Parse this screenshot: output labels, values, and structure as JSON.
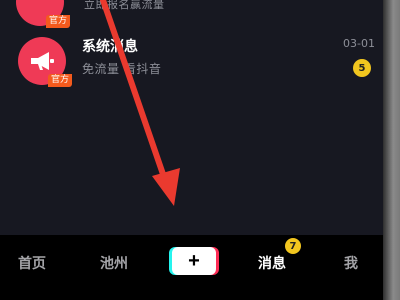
{
  "messages": {
    "prev_item": {
      "badge": "官方",
      "subtitle": "立即报名赢流量"
    },
    "system_item": {
      "title": "系统消息",
      "subtitle": "免流量 看抖音",
      "badge": "官方",
      "time": "03-01",
      "unread_count": "5",
      "icon": "megaphone-icon"
    }
  },
  "tab_bar": {
    "home": "首页",
    "pool": "池州",
    "add_icon": "+",
    "messages": "消息",
    "messages_badge": "7",
    "me": "我"
  },
  "annotation": {
    "icon": "red-arrow",
    "color": "#ea3a2f"
  },
  "colors": {
    "background": "#171821",
    "accent_red": "#ef3a56",
    "badge_yellow": "#f2c61f",
    "official_orange": "#f35a1d"
  }
}
